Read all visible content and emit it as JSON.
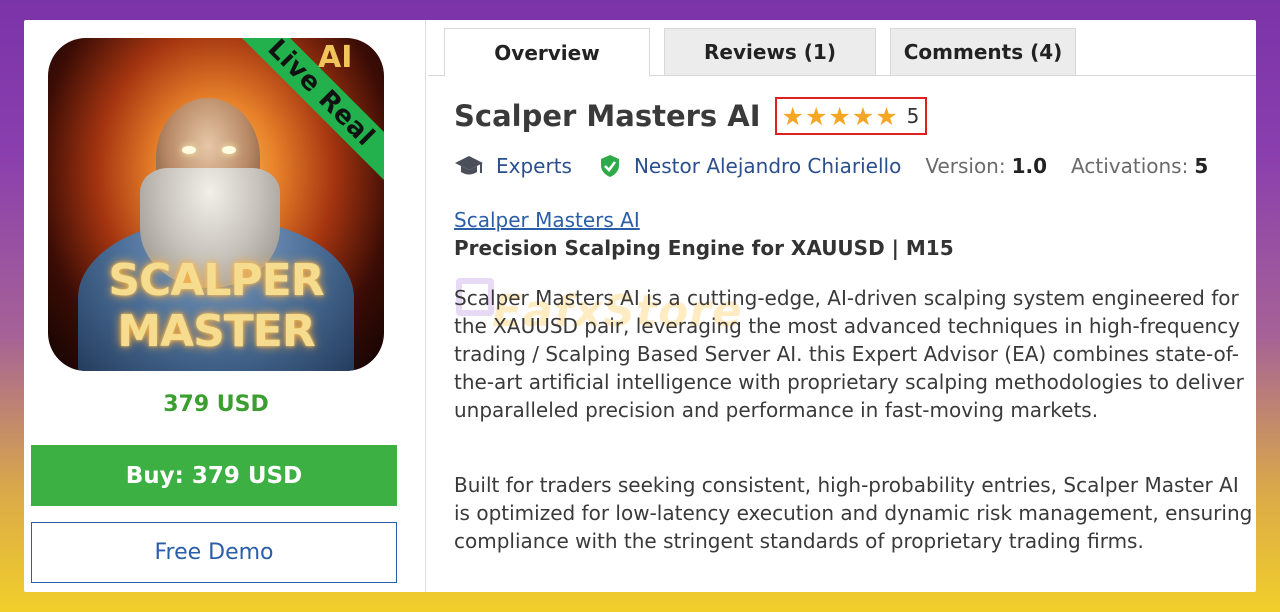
{
  "product_image": {
    "ribbon_text": "Live Real",
    "badge_text": "AI",
    "caption": "SCALPER MASTER"
  },
  "left": {
    "price": "379 USD",
    "buy_label": "Buy: 379 USD",
    "demo_label": "Free Demo"
  },
  "tabs": [
    {
      "label": "Overview",
      "active": true
    },
    {
      "label": "Reviews (1)",
      "active": false
    },
    {
      "label": "Comments (4)",
      "active": false
    }
  ],
  "product": {
    "title": "Scalper Masters AI",
    "rating_stars": 5,
    "rating_value": "5",
    "category": "Experts",
    "author": "Nestor Alejandro Chiariello",
    "version_label": "Version:",
    "version_value": "1.0",
    "activations_label": "Activations:",
    "activations_value": "5"
  },
  "description": {
    "link": "Scalper Masters AI",
    "heading": "Precision Scalping Engine for XAUUSD | M15",
    "paragraph_1": "Scalper Masters AI is a cutting-edge, AI-driven scalping system engineered for the XAUUSD pair, leveraging the most advanced techniques in high-frequency trading / Scalping Based Server AI. this Expert Advisor (EA) combines state-of-the-art artificial intelligence with proprietary scalping methodologies to deliver unparalleled precision and performance in fast-moving markets.",
    "paragraph_2": "Built for traders seeking consistent, high-probability entries, Scalper Master AI is optimized for low-latency execution and dynamic risk management, ensuring compliance with the stringent standards of proprietary trading firms."
  },
  "watermark": {
    "brand_a": "Eafx",
    "brand_b": "Store"
  },
  "colors": {
    "buy_green": "#3cb043",
    "price_green": "#3a9f2e",
    "link_blue": "#2b5ea8",
    "star_gold": "#f5a623",
    "rating_border": "#e0201e",
    "ribbon_green": "#22b14c"
  },
  "icons": {
    "category": "graduation-cap-icon",
    "author": "verified-shield-icon",
    "star": "star-icon"
  }
}
